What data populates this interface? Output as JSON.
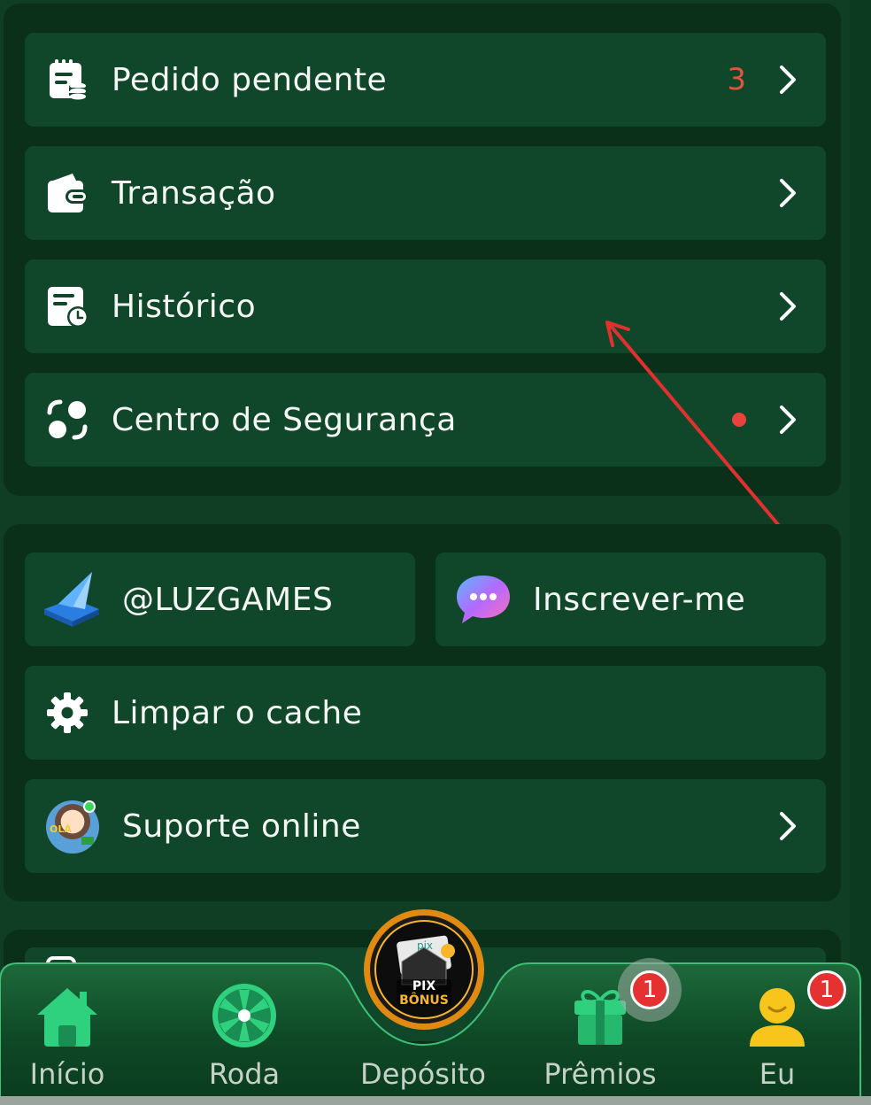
{
  "menu_group_1": {
    "items": [
      {
        "label": "Pedido pendente",
        "count": "3"
      },
      {
        "label": "Transação"
      },
      {
        "label": "Histórico"
      },
      {
        "label": "Centro de Segurança"
      }
    ]
  },
  "menu_group_2": {
    "telegram_label": "@LUZGAMES",
    "subscribe_label": "Inscrever-me",
    "clear_cache_label": "Limpar o cache",
    "support_label": "Suporte online",
    "avatar_text": "OLÁ"
  },
  "deposit_coin": {
    "text_top": "PIX",
    "text_bottom": "BÔNUS",
    "logo": "pix"
  },
  "bottom_nav": {
    "items": [
      {
        "label": "Início",
        "icon": "home-icon"
      },
      {
        "label": "Roda",
        "icon": "wheel-icon"
      },
      {
        "label": "Depósito",
        "icon": "pix-bonus-coin"
      },
      {
        "label": "Prêmios",
        "icon": "gift-icon",
        "badge": "1"
      },
      {
        "label": "Eu",
        "icon": "user-icon",
        "badge": "1"
      }
    ]
  },
  "colors": {
    "background": "#0f3e24",
    "card": "#0a3019",
    "row": "#10472a",
    "accent_green": "#2bd47a",
    "active_yellow": "#f3d02a",
    "badge_red": "#e5312f",
    "count_red": "#e5533b"
  }
}
